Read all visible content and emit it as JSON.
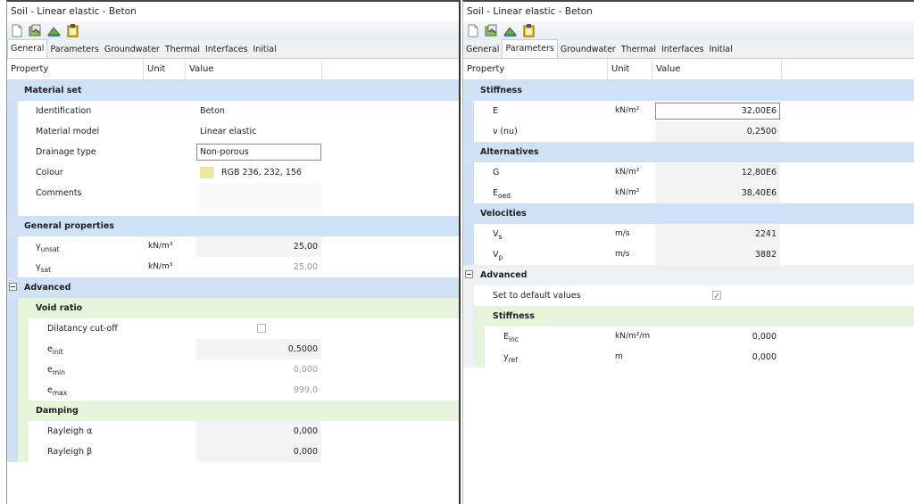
{
  "left": {
    "title": "Soil - Linear elastic - Beton",
    "toolbar": [
      "new-icon",
      "open-icon",
      "soil-icon",
      "clipboard-icon"
    ],
    "tabs": [
      "General",
      "Parameters",
      "Groundwater",
      "Thermal",
      "Interfaces",
      "Initial"
    ],
    "active_tab": "General",
    "header": {
      "property": "Property",
      "unit": "Unit",
      "value": "Value"
    },
    "material_set": {
      "label": "Material set",
      "identification_label": "Identification",
      "identification_value": "Beton",
      "material_model_label": "Material model",
      "material_model_value": "Linear elastic",
      "drainage_type_label": "Drainage type",
      "drainage_type_value": "Non-porous",
      "colour_label": "Colour",
      "colour_value": "RGB 236, 232, 156",
      "colour_hex": "#ece89c",
      "comments_label": "Comments"
    },
    "general_properties": {
      "label": "General properties",
      "gamma_unsat": {
        "sym": "γ",
        "sub": "unsat",
        "unit": "kN/m³",
        "value": "25,00"
      },
      "gamma_sat": {
        "sym": "γ",
        "sub": "sat",
        "unit": "kN/m³",
        "value": "25,00"
      }
    },
    "advanced": {
      "label": "Advanced",
      "void_ratio_label": "Void ratio",
      "dilatancy_label": "Dilatancy cut-off",
      "e_init": {
        "sym": "e",
        "sub": "init",
        "value": "0,5000"
      },
      "e_min": {
        "sym": "e",
        "sub": "min",
        "value": "0,000"
      },
      "e_max": {
        "sym": "e",
        "sub": "max",
        "value": "999,0"
      },
      "damping_label": "Damping",
      "rayleigh_alpha": {
        "label": "Rayleigh α",
        "value": "0,000"
      },
      "rayleigh_beta": {
        "label": "Rayleigh β",
        "value": "0,000"
      }
    }
  },
  "right": {
    "title": "Soil - Linear elastic - Beton",
    "tabs": [
      "General",
      "Parameters",
      "Groundwater",
      "Thermal",
      "Interfaces",
      "Initial"
    ],
    "active_tab": "Parameters",
    "header": {
      "property": "Property",
      "unit": "Unit",
      "value": "Value"
    },
    "stiffness": {
      "label": "Stiffness",
      "E": {
        "label": "E",
        "unit": "kN/m²",
        "value": "32,00E6"
      },
      "nu": {
        "label": "ν (nu)",
        "value": "0,2500"
      }
    },
    "alternatives": {
      "label": "Alternatives",
      "G": {
        "label": "G",
        "unit": "kN/m²",
        "value": "12,80E6"
      },
      "Eoed": {
        "sym": "E",
        "sub": "oed",
        "unit": "kN/m²",
        "value": "38,40E6"
      }
    },
    "velocities": {
      "label": "Velocities",
      "Vs": {
        "sym": "V",
        "sub": "s",
        "unit": "m/s",
        "value": "2241"
      },
      "Vp": {
        "sym": "V",
        "sub": "p",
        "unit": "m/s",
        "value": "3882"
      }
    },
    "advanced": {
      "label": "Advanced",
      "default_label": "Set to default values",
      "stiffness_label": "Stiffness",
      "Einc": {
        "sym": "E",
        "sub": "inc",
        "unit": "kN/m²/m",
        "value": "0,000"
      },
      "yref": {
        "sym": "y",
        "sub": "ref",
        "unit": "m",
        "value": "0,000"
      }
    }
  },
  "colors": {
    "category_bg": "#cfe1f5",
    "subcategory_bg": "#e5f4da",
    "colour_swatch": "#ece89c"
  }
}
